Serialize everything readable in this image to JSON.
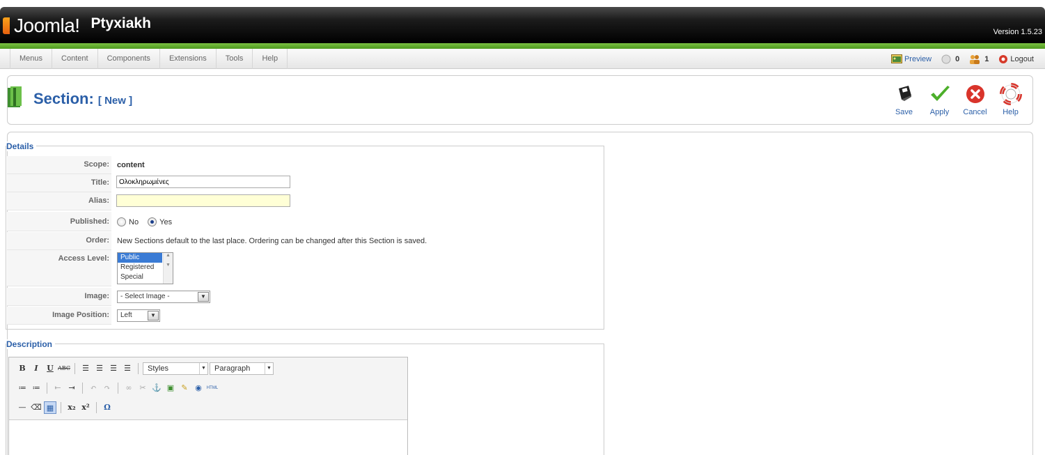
{
  "header": {
    "logo_text": "Joomla!",
    "site_name": "Ptyxiakh",
    "version": "Version 1.5.23"
  },
  "menu": [
    "Menus",
    "Content",
    "Components",
    "Extensions",
    "Tools",
    "Help"
  ],
  "status": {
    "preview": "Preview",
    "messages_count": "0",
    "users_count": "1",
    "logout": "Logout"
  },
  "toolbar": {
    "title": "Section:",
    "title_tag": "[ New ]",
    "buttons": {
      "save": "Save",
      "apply": "Apply",
      "cancel": "Cancel",
      "help": "Help"
    }
  },
  "details": {
    "legend": "Details",
    "scope_label": "Scope:",
    "scope_value": "content",
    "title_label": "Title:",
    "title_value": "Ολοκληρωμένες",
    "alias_label": "Alias:",
    "alias_value": "",
    "published_label": "Published:",
    "published_no": "No",
    "published_yes": "Yes",
    "order_label": "Order:",
    "order_text": "New Sections default to the last place. Ordering can be changed after this Section is saved.",
    "access_label": "Access Level:",
    "access_options": [
      "Public",
      "Registered",
      "Special"
    ],
    "image_label": "Image:",
    "image_value": "- Select Image -",
    "image_position_label": "Image Position:",
    "image_position_value": "Left"
  },
  "description": {
    "legend": "Description",
    "styles_value": "Styles",
    "format_value": "Paragraph"
  },
  "colors": {
    "accent_blue": "#2b5fa8",
    "header_green": "#6db33f",
    "alias_bg": "#ffffd6"
  }
}
